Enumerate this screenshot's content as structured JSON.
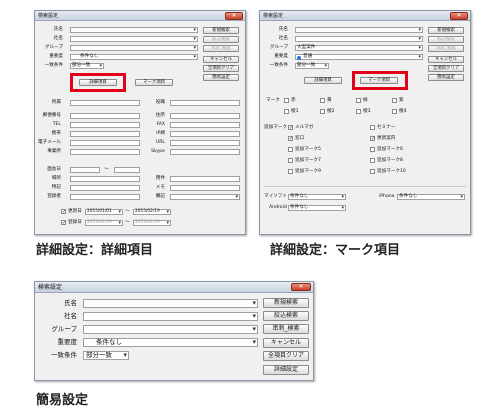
{
  "common": {
    "window_title": "検索設定",
    "close": "✕",
    "labels": {
      "name": "氏名",
      "company": "社名",
      "group": "グループ",
      "importance": "重要度",
      "match": "一致条件"
    },
    "values": {
      "importance_simple": "条件なし",
      "importance_mark": "普通",
      "match": "部分一致",
      "group_mark": "大型案件"
    },
    "buttons": {
      "new_search": "新規検索",
      "narrow": "絞込検索",
      "extract": "串刺_検索",
      "cancel": "キャンセル",
      "clear": "全項目クリア",
      "simple": "簡易設定",
      "detail": "詳細設定",
      "detail_items": "詳細項目",
      "mark_items": "マーク項目"
    }
  },
  "detail": {
    "fields": {
      "belong": "所属",
      "position": "役職",
      "zip": "郵便番号",
      "address": "住所",
      "tel": "TEL",
      "fax": "FAX",
      "mobile": "携帯",
      "ip": "IP網",
      "email": "電子メール",
      "url": "URL",
      "office": "事業所",
      "skype": "Skype",
      "meet_date": "面会日",
      "place": "場所",
      "business": "用件",
      "note": "特記",
      "memo": "メモ",
      "registrant": "登録者",
      "remarks": "備記"
    },
    "tilde": "〜",
    "updated": {
      "label": "更新日",
      "from": "2015/01/01",
      "to": "2015/02/19"
    },
    "registered": {
      "label": "登録日",
      "from": "2015/02/19",
      "to": "2015/02/19"
    }
  },
  "mark": {
    "mark_label": "マーク",
    "colors": [
      "赤",
      "黄",
      "緑",
      "紫",
      "橙",
      "橙1",
      "橙2",
      "橙3",
      "橙4"
    ],
    "add_mark": "追加マーク",
    "add_items": [
      "メルマガ",
      "セミナー",
      "窓口",
      "更新案内",
      "追加マーク5",
      "追加マーク6",
      "追加マーク7",
      "追加マーク8",
      "追加マーク9",
      "追加マーク10"
    ],
    "mysoft_label": "マイソフト",
    "mysoft_value": "条件なし",
    "iphone_label": "iPhone",
    "iphone_value": "条件なし",
    "android_label": "Android",
    "android_value": "条件なし"
  },
  "captions": {
    "detail": "詳細設定：詳細項目",
    "mark": "詳細設定：マーク項目",
    "simple": "簡易設定"
  },
  "accent": "#e3001b"
}
